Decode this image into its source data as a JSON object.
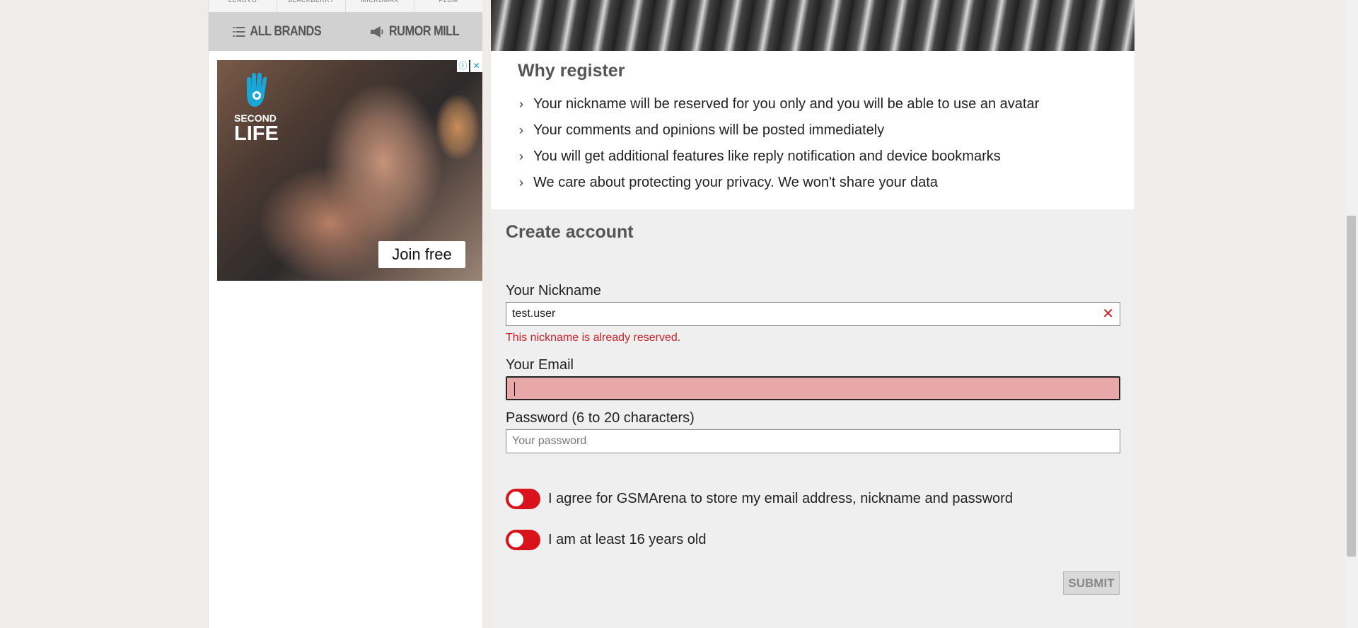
{
  "sidebar": {
    "brand_row": [
      "LENOVO",
      "BLACKBERRY",
      "MICROMAX",
      "PLUM"
    ],
    "tabs": [
      {
        "label": "All Brands",
        "icon": "list-icon"
      },
      {
        "label": "Rumor Mill",
        "icon": "megaphone-icon"
      }
    ],
    "ad": {
      "logo_line1": "SECOND",
      "logo_line2": "LIFE",
      "cta": "Join free",
      "info_icon": "info-icon",
      "close_icon": "close-icon"
    }
  },
  "register": {
    "heading": "Why register",
    "items": [
      "Your nickname will be reserved for you only and you will be able to use an avatar",
      "Your comments and opinions will be posted immediately",
      "You will get additional features like reply notification and device bookmarks",
      "We care about protecting your privacy. We won't share your data"
    ]
  },
  "form": {
    "heading": "Create account",
    "nickname": {
      "label": "Your Nickname",
      "value": "test.user",
      "error": "This nickname is already reserved."
    },
    "email": {
      "label": "Your Email",
      "value": ""
    },
    "password": {
      "label": "Password (6 to 20 characters)",
      "placeholder": "Your password"
    },
    "agree_storage": "I agree for GSMArena to store my email address, nickname and password",
    "agree_age": "I am at least 16 years old",
    "submit_label": "SUBMIT"
  },
  "colors": {
    "error": "#c8232c",
    "toggle": "#d8131b",
    "email_bg": "#e8a8a8"
  }
}
